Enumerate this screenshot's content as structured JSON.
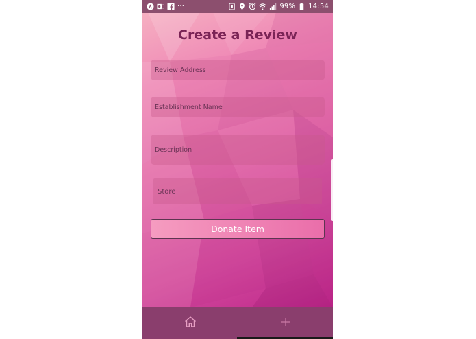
{
  "status_bar": {
    "left_icons": [
      "android-auto-icon",
      "outlook-icon",
      "facebook-icon",
      "more-icon"
    ],
    "more_text": "···",
    "right_icons": [
      "nfc-icon",
      "location-icon",
      "alarm-icon",
      "wifi-icon",
      "signal-icon"
    ],
    "battery": "99%",
    "time": "14:54"
  },
  "form": {
    "title": "Create a Review",
    "review_address_placeholder": "Review Address",
    "establishment_name_placeholder": "Establishment Name",
    "description_placeholder": "Description",
    "store_placeholder": "Store",
    "donate_label": "Donate Item"
  },
  "bottom_nav": {
    "items": [
      {
        "icon": "home-icon"
      },
      {
        "icon": "plus-icon"
      }
    ]
  },
  "colors": {
    "title": "#7a2456",
    "status_bar": "#8c4f6e",
    "nav_bar": "#8a3e6d",
    "nav_icon": "#e8a0c4"
  }
}
